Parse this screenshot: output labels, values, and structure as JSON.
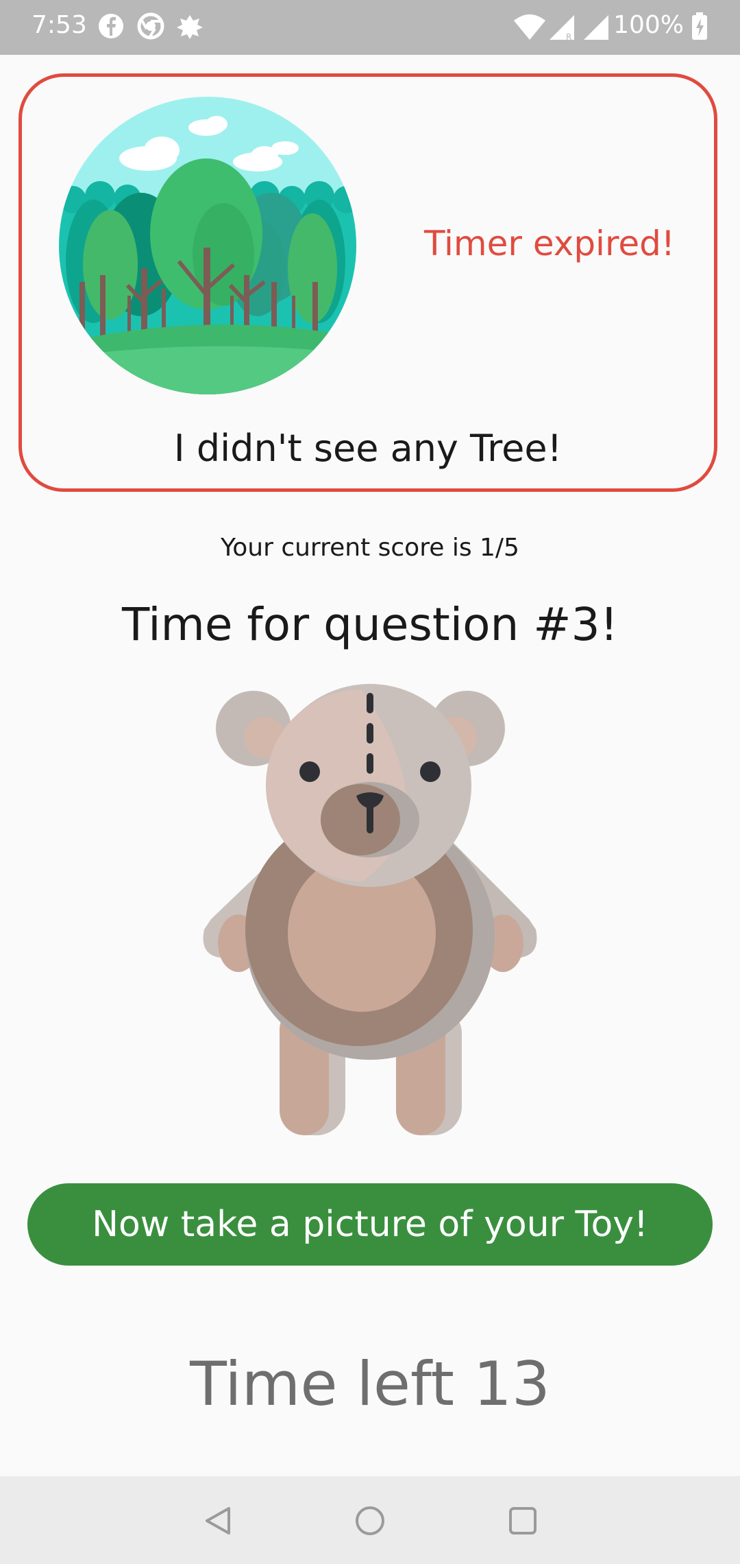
{
  "status_bar": {
    "time": "7:53",
    "battery": "100%",
    "icons": [
      "facebook-icon",
      "chrome-icon",
      "app-notification-icon",
      "wifi-icon",
      "signal-r-icon",
      "signal-icon",
      "battery-charging-icon"
    ]
  },
  "result_card": {
    "status_text": "Timer expired!",
    "message": "I didn't see any Tree!",
    "image": "forest-illustration",
    "border_color": "#e04b3f"
  },
  "score": {
    "text": "Your current score is 1/5"
  },
  "question": {
    "title": "Time for question #3!",
    "image": "teddy-bear-illustration"
  },
  "action": {
    "label": "Now take a picture of your Toy!",
    "color": "#3a8f3e"
  },
  "timer": {
    "text": "Time left 13"
  },
  "nav_bar": {
    "buttons": [
      "back-icon",
      "home-icon",
      "recents-icon"
    ]
  }
}
